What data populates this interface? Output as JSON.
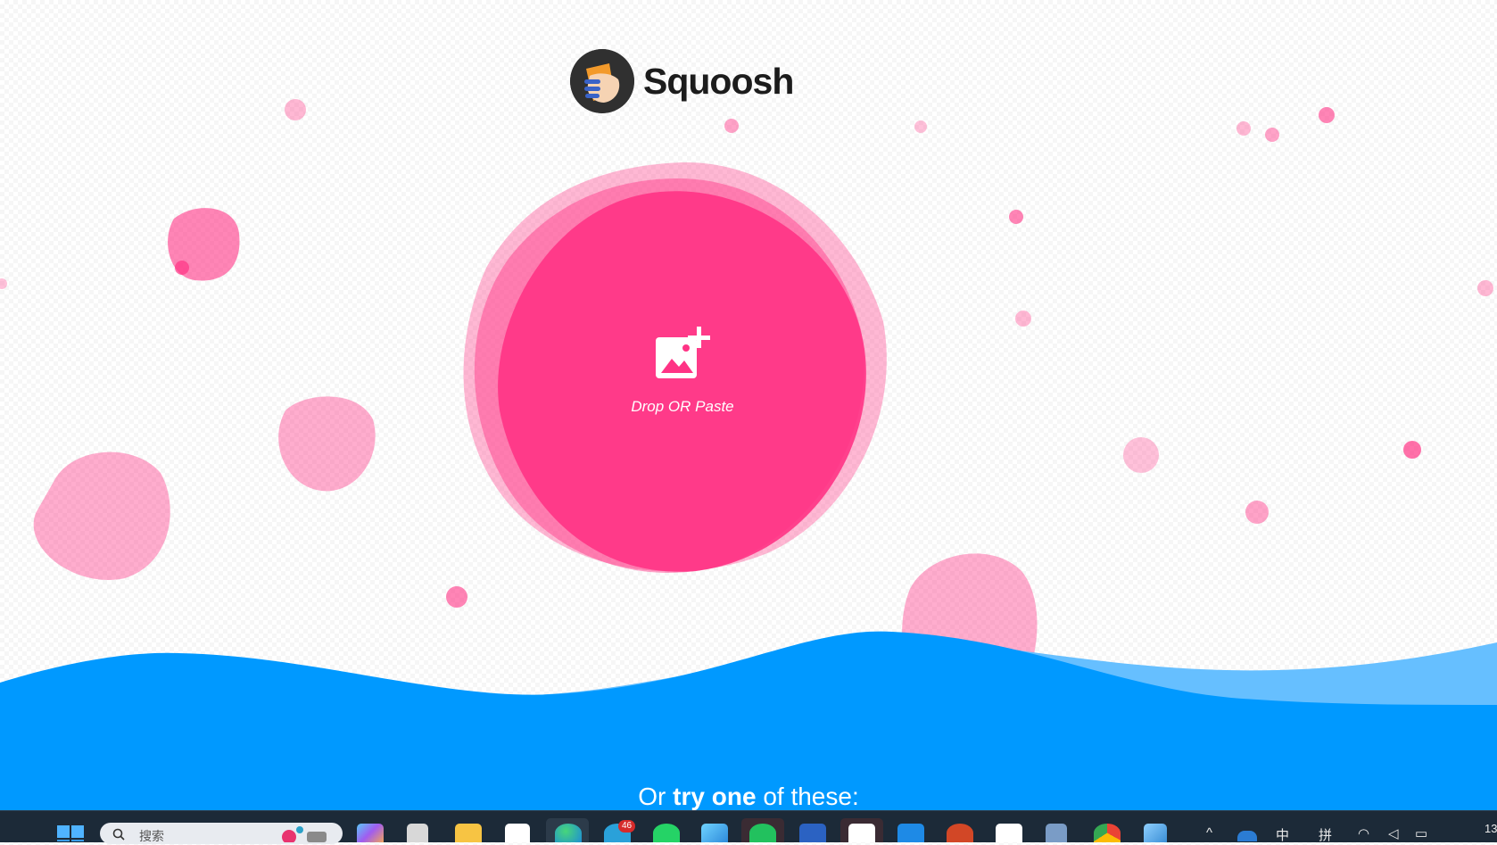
{
  "app": {
    "name": "Squoosh",
    "brand_color": "#ff3385",
    "wave_color": "#0099ff",
    "wave_light_color": "#66bfff"
  },
  "drop_zone": {
    "label": "Drop OR Paste",
    "icon": "add-image-icon"
  },
  "demo_section": {
    "prefix": "Or",
    "emphasis": "try one",
    "suffix": "of these:"
  },
  "taskbar": {
    "search_placeholder": "搜索",
    "icons": [
      "windows-start-icon",
      "search-icon",
      "copilot-icon",
      "file-icon",
      "file-explorer-icon",
      "microsoft-store-icon",
      "edge-icon",
      "telegram-icon",
      "whatsapp-icon",
      "photos-icon",
      "wechat-icon",
      "word-icon",
      "qq-icon",
      "vscode-icon",
      "powerpoint-icon",
      "app-icon",
      "remote-desktop-icon",
      "chrome-icon",
      "app-icon-2"
    ],
    "telegram_badge": "46",
    "tray_ime": "中",
    "tray_ime_mode": "拼",
    "clock_partial": "13"
  }
}
